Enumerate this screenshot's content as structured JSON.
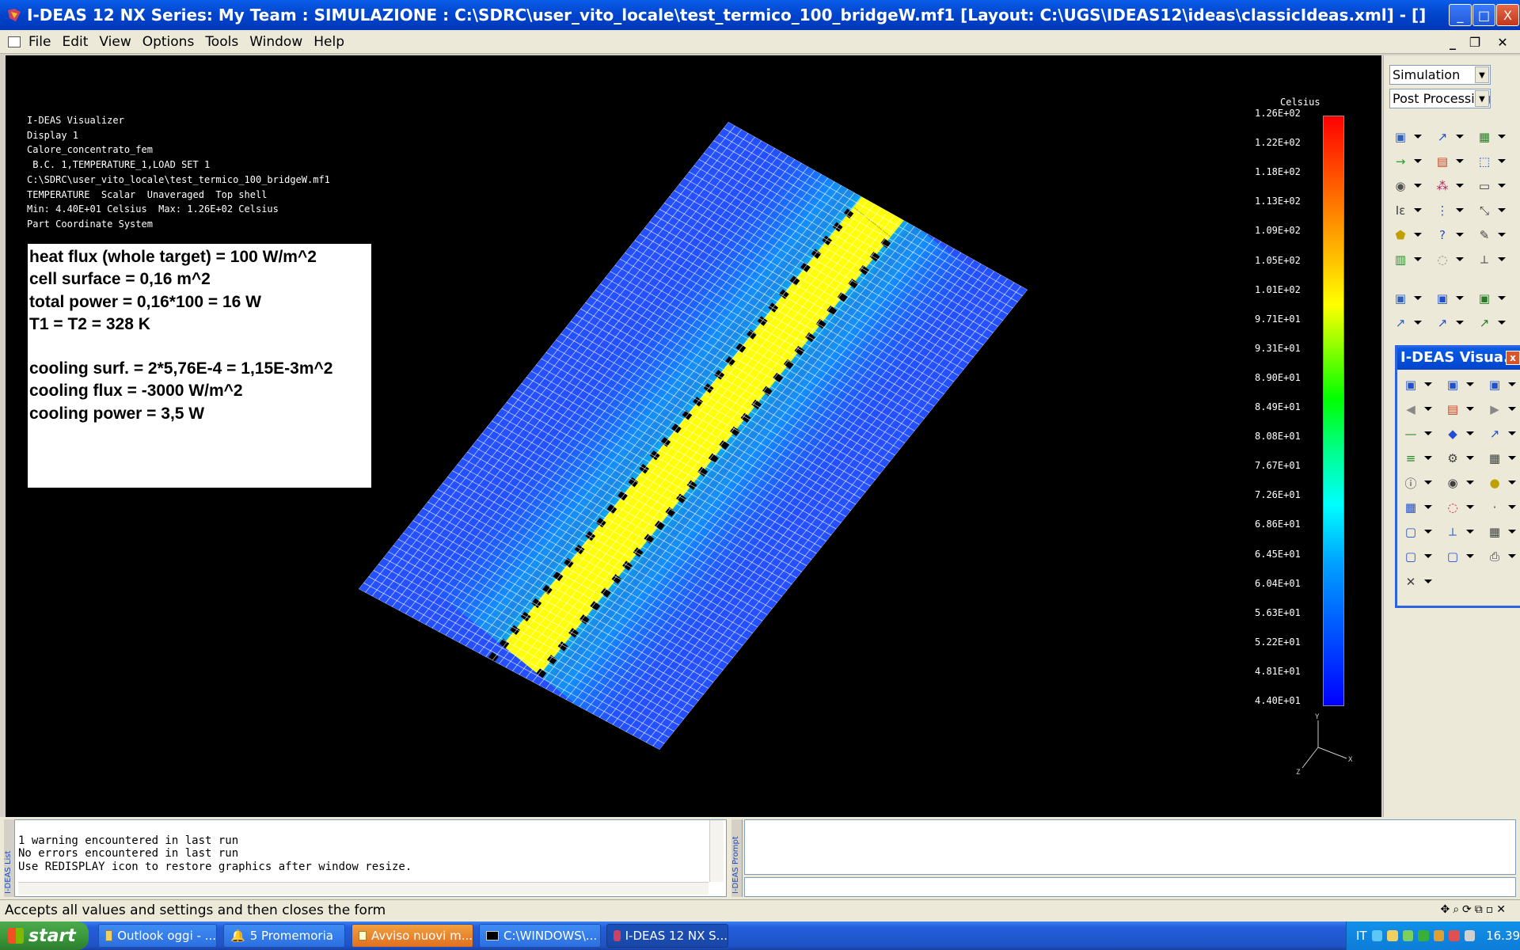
{
  "window": {
    "title": "I-DEAS 12 NX Series:    My Team : SIMULAZIONE : C:\\SDRC\\user_vito_locale\\test_termico_100_bridgeW.mf1    [Layout: C:\\UGS\\IDEAS12\\ideas\\classicIdeas.xml]    - []",
    "minimize": "_",
    "maximize": "□",
    "close": "X"
  },
  "menu": [
    "File",
    "Edit",
    "View",
    "Options",
    "Tools",
    "Window",
    "Help"
  ],
  "viewport": {
    "info_lines": [
      "I-DEAS Visualizer",
      "Display 1",
      "Calore_concentrato_fem",
      " B.C. 1,TEMPERATURE_1,LOAD SET 1",
      "C:\\SDRC\\user_vito_locale\\test_termico_100_bridgeW.mf1",
      "TEMPERATURE  Scalar  Unaveraged  Top shell",
      "Min: 4.40E+01 Celsius  Max: 1.26E+02 Celsius",
      "Part Coordinate System"
    ],
    "notes": [
      "heat flux (whole target) = 100 W/m^2",
      "cell surface = 0,16 m^2",
      "total power = 0,16*100 = 16 W",
      "T1 = T2 = 328 K",
      "",
      "cooling surf. = 2*5,76E-4 = 1,15E-3m^2",
      "cooling flux = -3000 W/m^2",
      "cooling power = 3,5 W"
    ],
    "legend": {
      "unit": "Celsius",
      "labels": [
        "1.26E+02",
        "1.22E+02",
        "1.18E+02",
        "1.13E+02",
        "1.09E+02",
        "1.05E+02",
        "1.01E+02",
        "9.71E+01",
        "9.31E+01",
        "8.90E+01",
        "8.49E+01",
        "8.08E+01",
        "7.67E+01",
        "7.26E+01",
        "6.86E+01",
        "6.45E+01",
        "6.04E+01",
        "5.63E+01",
        "5.22E+01",
        "4.81E+01",
        "4.40E+01"
      ]
    },
    "triad": {
      "y": "Y",
      "z": "Z",
      "x": "X"
    }
  },
  "right_panel": {
    "task_select": "Simulation",
    "subtask_select": "Post Processing",
    "vis_panel_title": "I-DEAS Visua..."
  },
  "list_panel": {
    "tab_label": "I-DEAS List",
    "text": "1 warning encountered in last run\nNo errors encountered in last run\nUse REDISPLAY icon to restore graphics after window resize."
  },
  "prompt_panel": {
    "tab_label": "I-DEAS Prompt"
  },
  "statusbar": {
    "text": "Accepts all values and settings and then closes the form"
  },
  "taskbar": {
    "start": "start",
    "tasks": [
      "Outlook oggi - ...",
      "5 Promemoria",
      "Avviso nuovi m...",
      "C:\\WINDOWS\\...",
      "I-DEAS 12 NX S..."
    ],
    "lang": "IT",
    "clock": "16.39"
  },
  "colors": {
    "title_blue": "#0044cc",
    "viewport_bg": "#000000",
    "mesh_line": "#ffffff"
  }
}
